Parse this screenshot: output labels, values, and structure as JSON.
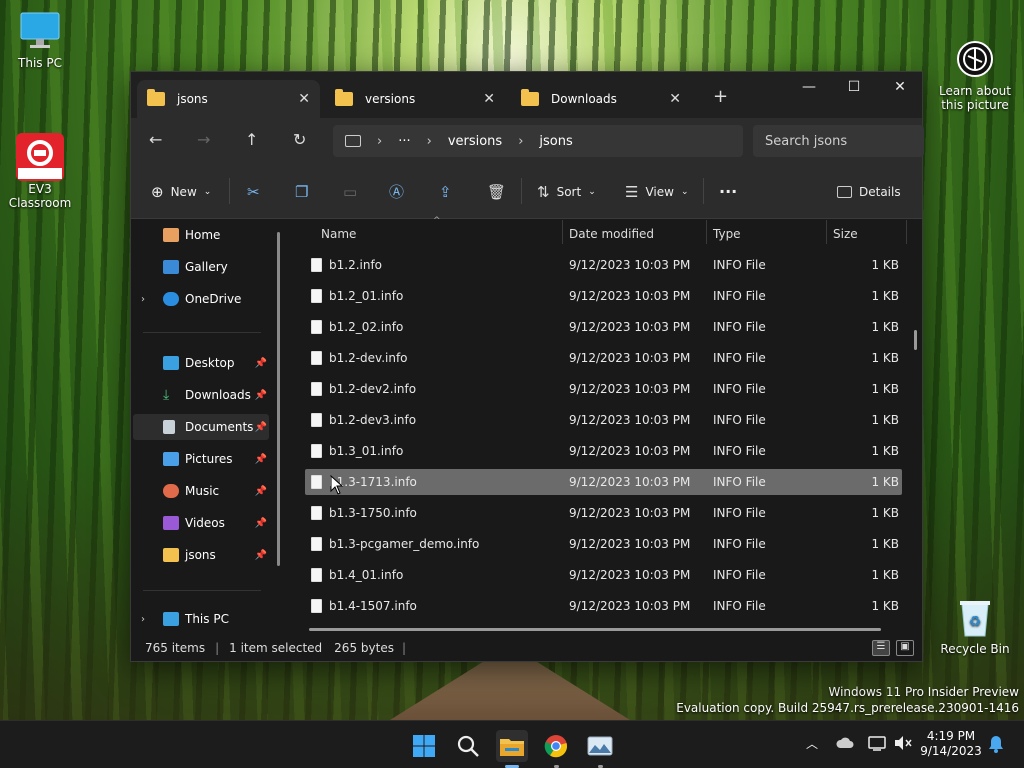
{
  "desktop": {
    "icons": [
      {
        "label": "This PC"
      },
      {
        "label": "EV3\nClassroom"
      },
      {
        "label": "Learn about\nthis picture"
      },
      {
        "label": "Recycle Bin"
      }
    ],
    "watermark_line1": "Windows 11 Pro Insider Preview",
    "watermark_line2": "Evaluation copy. Build 25947.rs_prerelease.230901-1416"
  },
  "window": {
    "tabs": [
      {
        "label": "jsons",
        "active": true
      },
      {
        "label": "versions",
        "active": false
      },
      {
        "label": "Downloads",
        "active": false
      }
    ],
    "new_tab": "+",
    "controls": {
      "minimize": "—",
      "maximize": "☐",
      "close": "✕"
    },
    "nav": {
      "back": "←",
      "forward": "→",
      "up": "↑",
      "refresh": "↻"
    },
    "address": {
      "more": "···",
      "crumbs": [
        "versions",
        "jsons"
      ]
    },
    "search_placeholder": "Search jsons",
    "toolbar": {
      "new_label": "New",
      "sort_label": "Sort",
      "view_label": "View",
      "more_label": "···",
      "details_label": "Details"
    },
    "sidebar": {
      "home": "Home",
      "gallery": "Gallery",
      "onedrive": "OneDrive",
      "desktop": "Desktop",
      "downloads": "Downloads",
      "documents": "Documents",
      "pictures": "Pictures",
      "music": "Music",
      "videos": "Videos",
      "jsons": "jsons",
      "thispc": "This PC"
    },
    "columns": {
      "name": "Name",
      "date": "Date modified",
      "type": "Type",
      "size": "Size"
    },
    "files": [
      {
        "name": "b1.2.info",
        "date": "9/12/2023 10:03 PM",
        "type": "INFO File",
        "size": "1 KB"
      },
      {
        "name": "b1.2_01.info",
        "date": "9/12/2023 10:03 PM",
        "type": "INFO File",
        "size": "1 KB"
      },
      {
        "name": "b1.2_02.info",
        "date": "9/12/2023 10:03 PM",
        "type": "INFO File",
        "size": "1 KB"
      },
      {
        "name": "b1.2-dev.info",
        "date": "9/12/2023 10:03 PM",
        "type": "INFO File",
        "size": "1 KB"
      },
      {
        "name": "b1.2-dev2.info",
        "date": "9/12/2023 10:03 PM",
        "type": "INFO File",
        "size": "1 KB"
      },
      {
        "name": "b1.2-dev3.info",
        "date": "9/12/2023 10:03 PM",
        "type": "INFO File",
        "size": "1 KB"
      },
      {
        "name": "b1.3_01.info",
        "date": "9/12/2023 10:03 PM",
        "type": "INFO File",
        "size": "1 KB"
      },
      {
        "name": "b1.3-1713.info",
        "date": "9/12/2023 10:03 PM",
        "type": "INFO File",
        "size": "1 KB"
      },
      {
        "name": "b1.3-1750.info",
        "date": "9/12/2023 10:03 PM",
        "type": "INFO File",
        "size": "1 KB"
      },
      {
        "name": "b1.3-pcgamer_demo.info",
        "date": "9/12/2023 10:03 PM",
        "type": "INFO File",
        "size": "1 KB"
      },
      {
        "name": "b1.4_01.info",
        "date": "9/12/2023 10:03 PM",
        "type": "INFO File",
        "size": "1 KB"
      },
      {
        "name": "b1.4-1507.info",
        "date": "9/12/2023 10:03 PM",
        "type": "INFO File",
        "size": "1 KB"
      }
    ],
    "selected_index": 7,
    "status": {
      "count": "765 items",
      "selection": "1 item selected",
      "size": "265 bytes"
    }
  },
  "taskbar": {
    "time": "4:19 PM",
    "date": "9/14/2023"
  },
  "colors": {
    "accent": "#79b6f0",
    "folder": "#f2c14e",
    "selection": "#6b6b6b"
  }
}
